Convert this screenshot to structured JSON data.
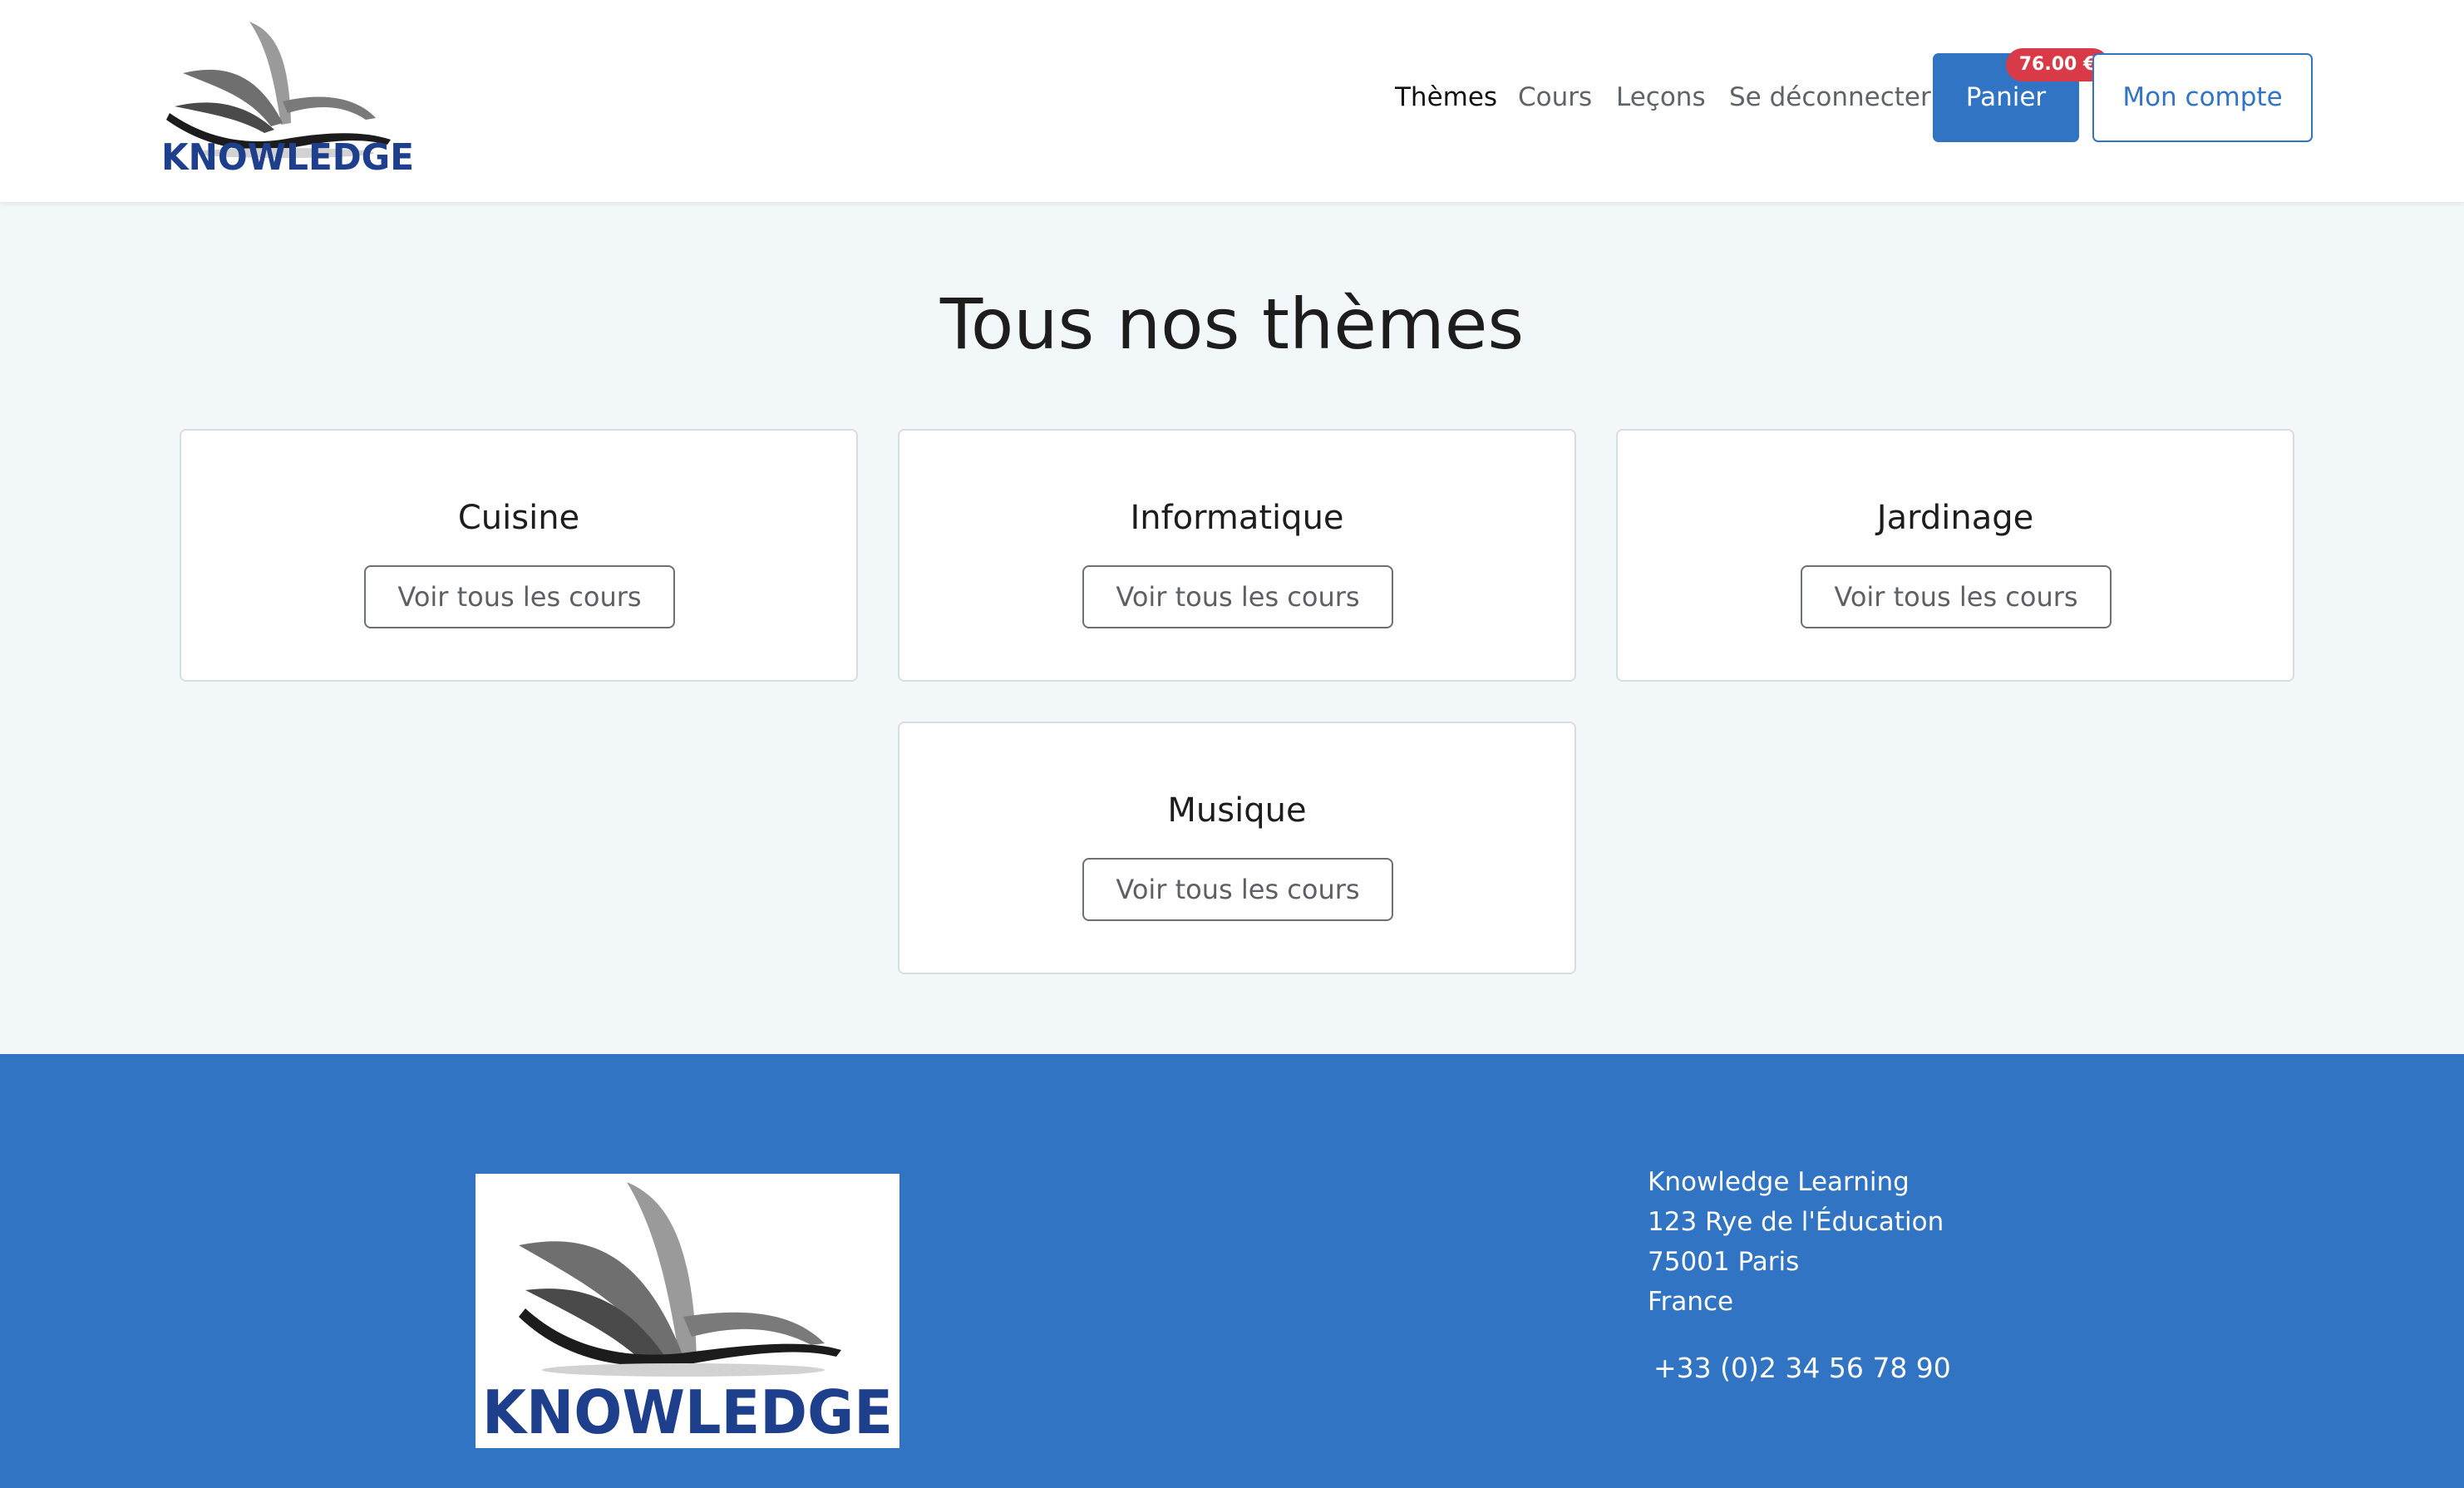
{
  "brand": {
    "logo_text": "KNOWLEDGE",
    "logo_color": "#1d3f8c",
    "icon": "open-book-icon"
  },
  "nav": {
    "links": [
      {
        "label": "Thèmes",
        "active": true
      },
      {
        "label": "Cours",
        "active": false
      },
      {
        "label": "Leçons",
        "active": false
      },
      {
        "label": "Se déconnecter",
        "active": false
      }
    ],
    "cart_label": "Panier",
    "cart_badge": "76.00 €",
    "account_label": "Mon compte"
  },
  "main": {
    "title": "Tous nos thèmes",
    "themes": [
      {
        "name": "Cuisine",
        "button": "Voir tous les cours"
      },
      {
        "name": "Informatique",
        "button": "Voir tous les cours"
      },
      {
        "name": "Jardinage",
        "button": "Voir tous les cours"
      },
      {
        "name": "Musique",
        "button": "Voir tous les cours"
      }
    ]
  },
  "footer": {
    "address": [
      "Knowledge Learning",
      "123 Rye de l'Éducation",
      "75001 Paris",
      "France"
    ],
    "phone": "+33 (0)2 34 56 78 90"
  },
  "colors": {
    "primary": "#3274c4",
    "badge": "#d93a47",
    "page_bg": "#f2f7fa"
  }
}
